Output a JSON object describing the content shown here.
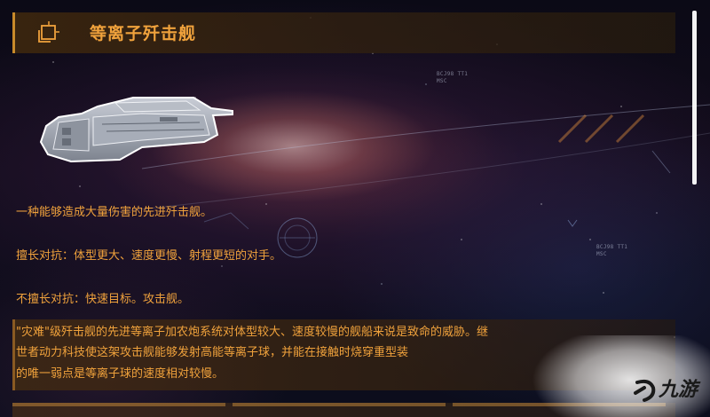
{
  "header": {
    "title": "等离子歼击舰",
    "icon": "ship-emblem-icon"
  },
  "ship_image": {
    "icon": "plasma-fighter-ship-icon"
  },
  "hud": {
    "label_a": "BCJ98 TT1",
    "label_a2": "MSC",
    "label_b": "BCJ98 TT1",
    "label_b2": "MSC"
  },
  "description": {
    "summary": "一种能够造成大量伤害的先进歼击舰。",
    "strong_against": "擅长对抗：体型更大、速度更慢、射程更短的对手。",
    "weak_against": "不擅长对抗：快速目标。攻击舰。"
  },
  "lore": {
    "line1": "\"灾难\"级歼击舰的先进等离子加农炮系统对体型较大、速度较慢的舰船来说是致命的威胁。继",
    "line2": "世者动力科技使这架攻击舰能够发射高能等离子球，并能在接触时烧穿重型装",
    "line3": "的唯一弱点是等离子球的速度相对较慢。"
  },
  "watermark": {
    "text": "九游",
    "icon": "jiuyou-logo-icon"
  },
  "colors": {
    "accent": "#f0a23c",
    "panel": "#3c260e",
    "scrollbar": "#ffffff"
  }
}
